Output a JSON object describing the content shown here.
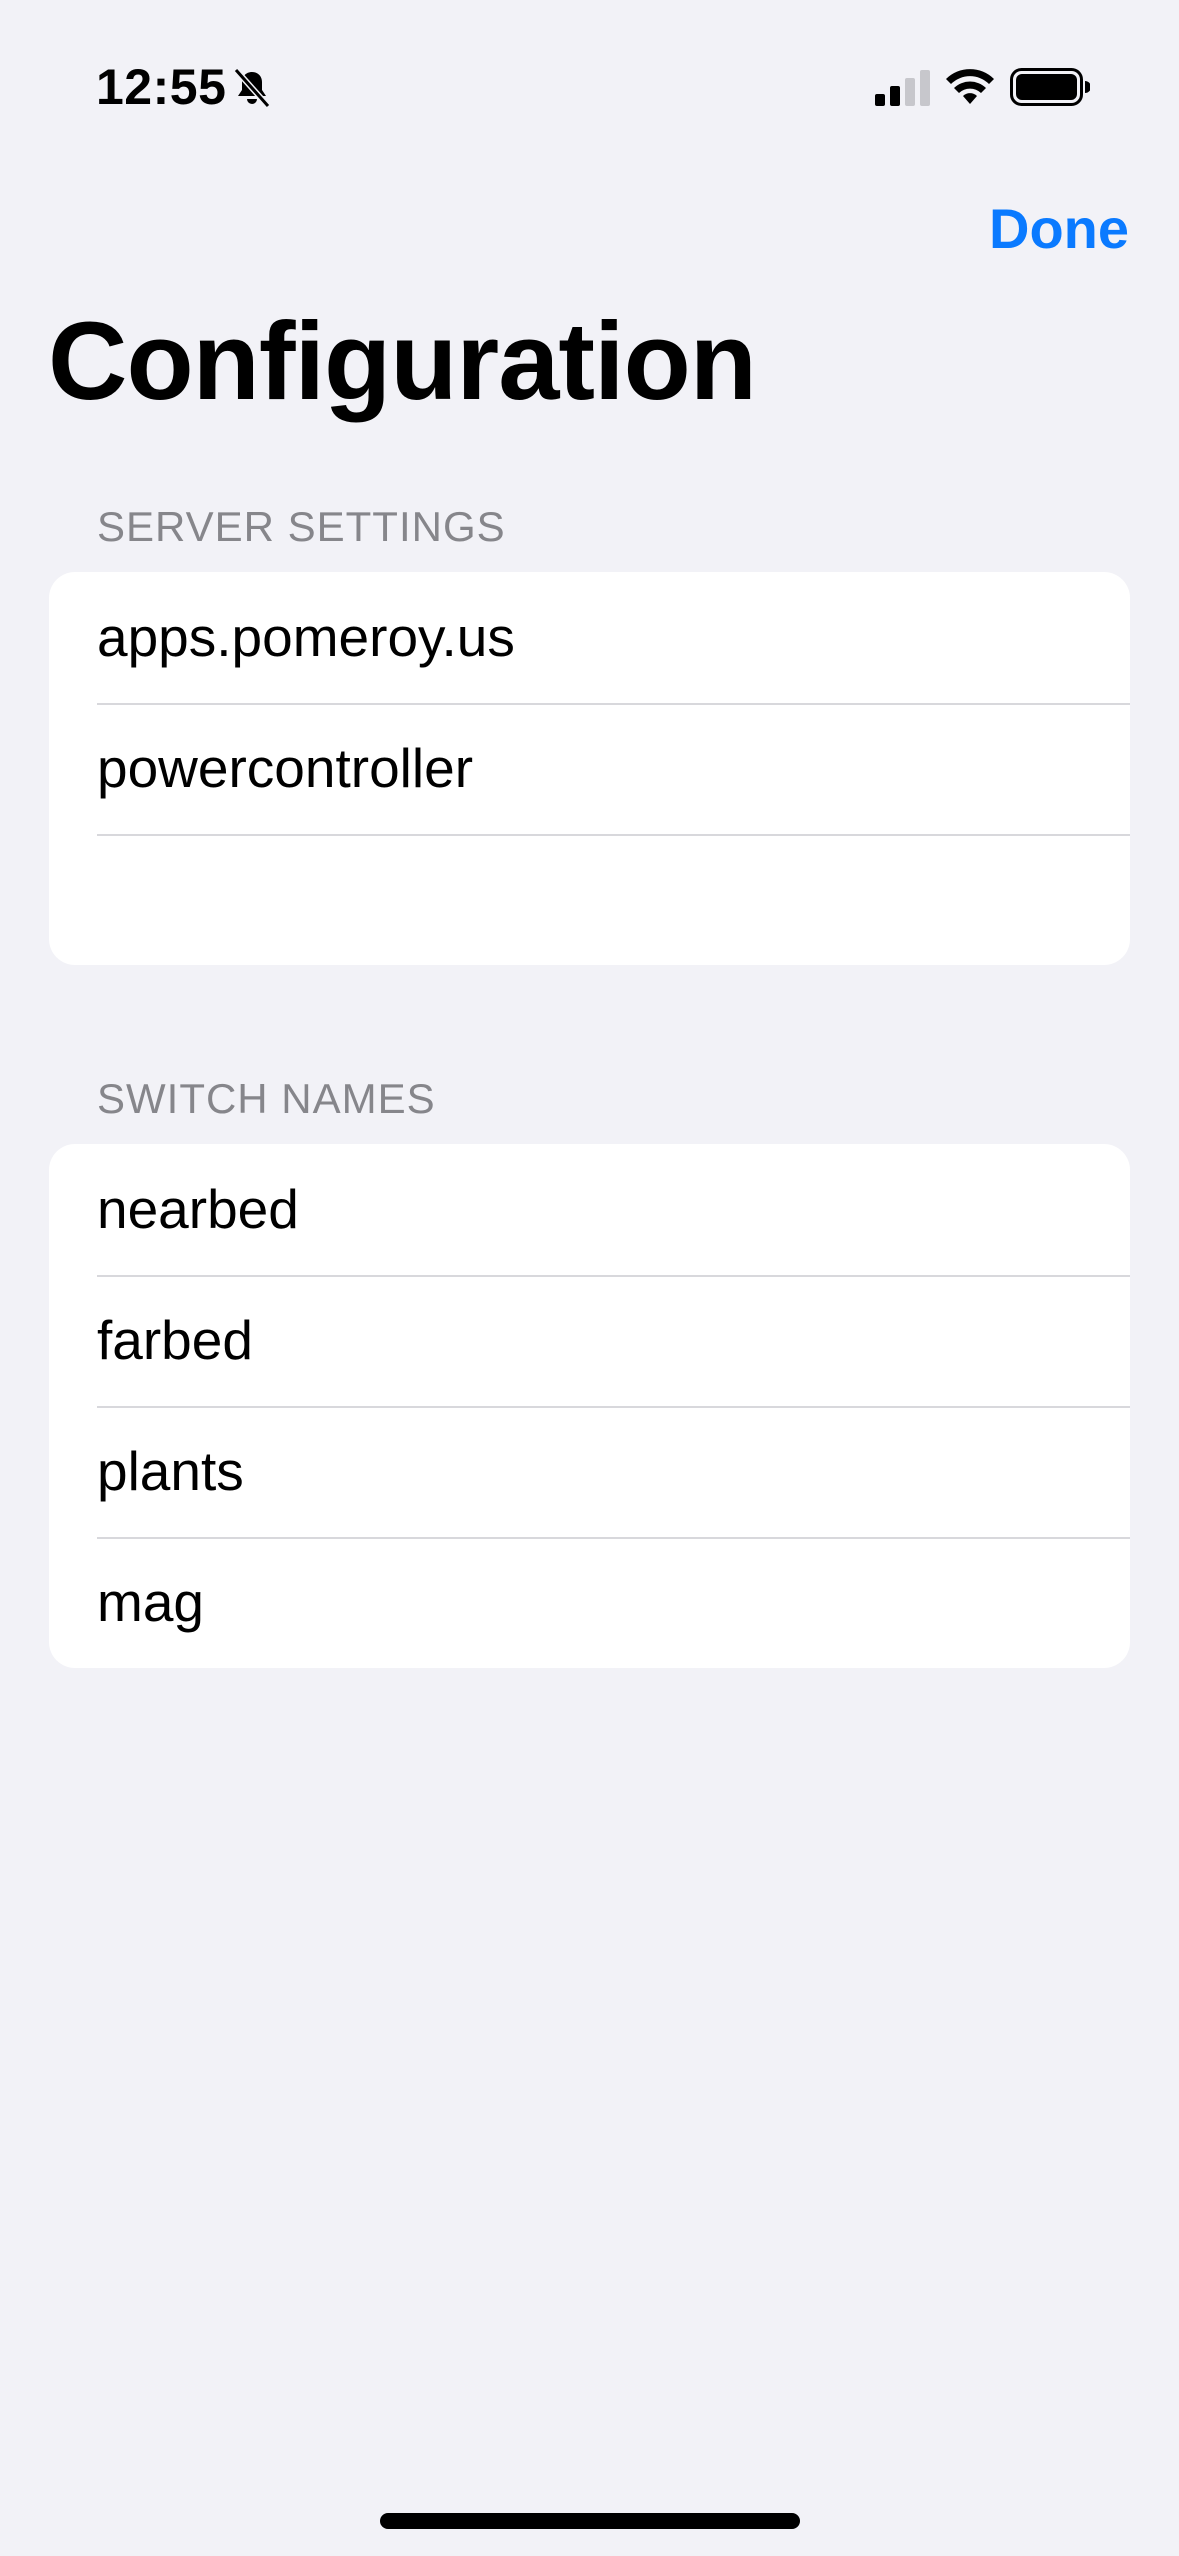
{
  "status_bar": {
    "time": "12:55",
    "icons": [
      "bell-slash-icon",
      "cellular-signal-icon",
      "wifi-icon",
      "battery-icon"
    ]
  },
  "nav": {
    "done_label": "Done",
    "title": "Configuration"
  },
  "server_settings": {
    "header": "SERVER SETTINGS",
    "fields": [
      "apps.pomeroy.us",
      "powercontroller",
      ""
    ]
  },
  "switch_names": {
    "header": "SWITCH NAMES",
    "fields": [
      "nearbed",
      "farbed",
      "plants",
      "mag"
    ]
  },
  "colors": {
    "accent": "#0a7aff",
    "background": "#f2f2f7",
    "header_text": "#86868b"
  }
}
